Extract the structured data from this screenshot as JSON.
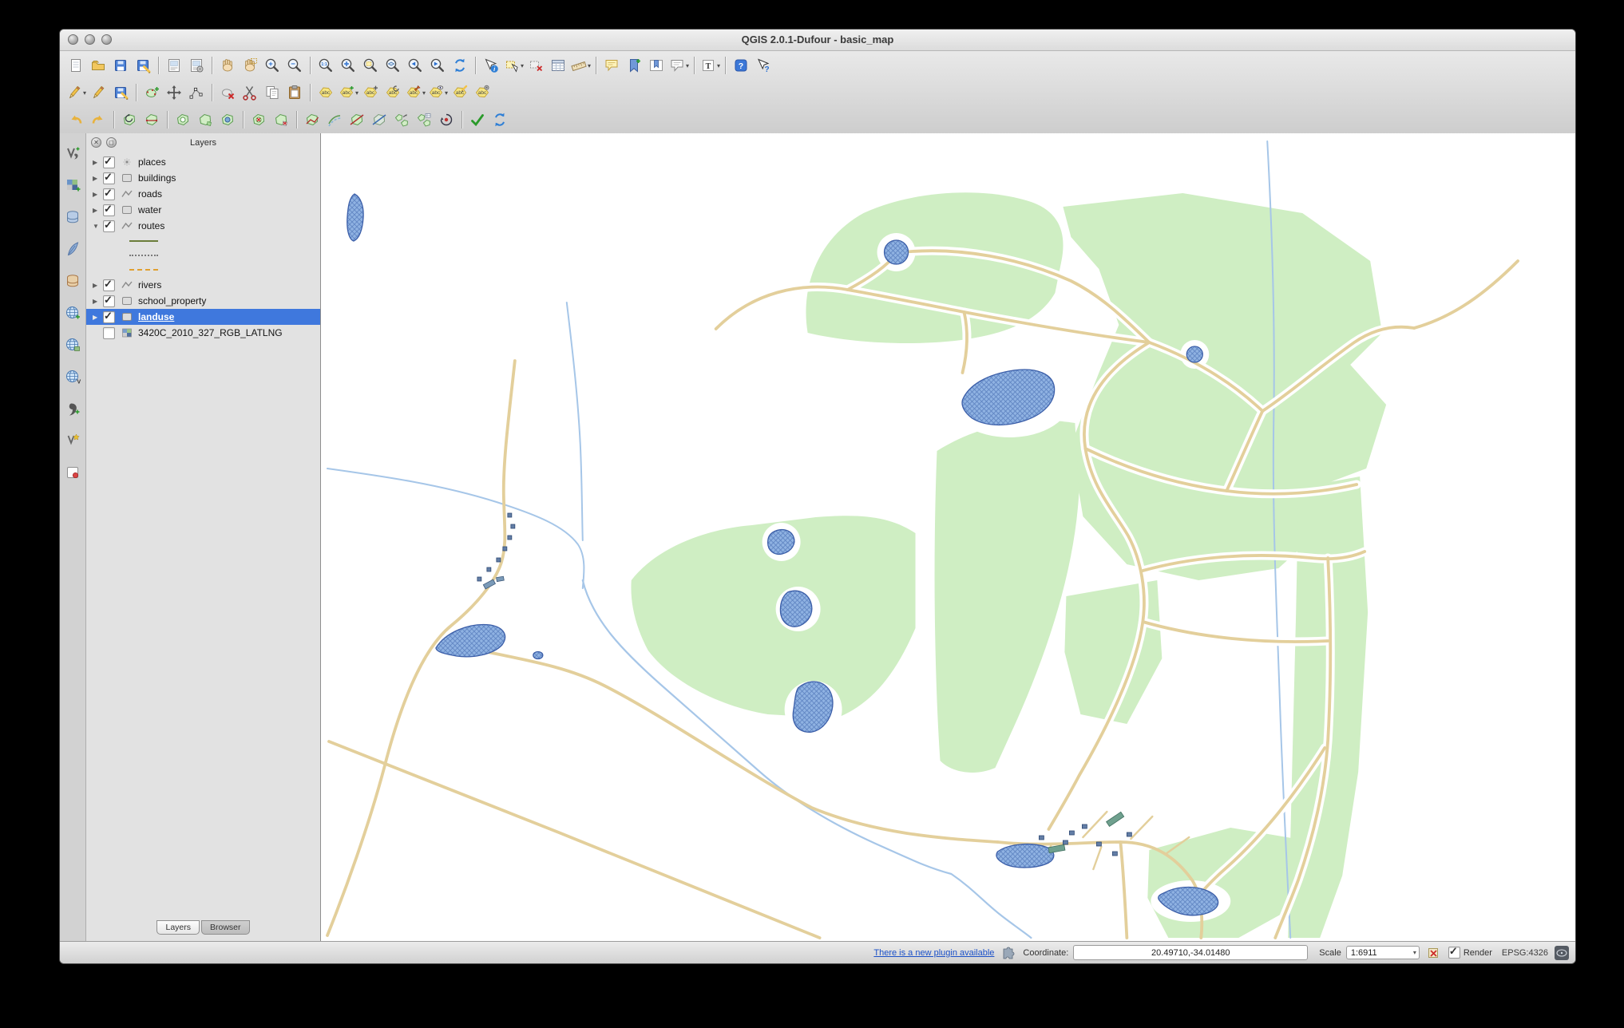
{
  "window": {
    "title": "QGIS 2.0.1-Dufour - basic_map"
  },
  "colors": {
    "selection": "#3f78dd",
    "landuse_green": "#cfeec3",
    "water_blue": "#8fb2e2",
    "road_tan": "#e3cf9b",
    "river_blue": "#a6c6e8"
  },
  "toolbars": {
    "main": [
      {
        "name": "new-project",
        "kind": "page"
      },
      {
        "name": "open-project",
        "kind": "folder"
      },
      {
        "name": "save-project",
        "kind": "floppy"
      },
      {
        "name": "save-project-as",
        "kind": "floppy-as"
      },
      {
        "sep": true
      },
      {
        "name": "new-print-composer",
        "kind": "composer"
      },
      {
        "name": "composer-manager",
        "kind": "composer-manager"
      },
      {
        "sep": true
      },
      {
        "name": "pan-map",
        "kind": "hand"
      },
      {
        "name": "pan-to-selection",
        "kind": "hand-sel"
      },
      {
        "name": "zoom-in",
        "kind": "zoom",
        "sub": "+"
      },
      {
        "name": "zoom-out",
        "kind": "zoom",
        "sub": "−"
      },
      {
        "sep": true
      },
      {
        "name": "zoom-native",
        "kind": "zoom",
        "sub": "1:1"
      },
      {
        "name": "zoom-full",
        "kind": "zoom-full"
      },
      {
        "name": "zoom-to-selection",
        "kind": "zoom-sel"
      },
      {
        "name": "zoom-to-layer",
        "kind": "zoom-layer"
      },
      {
        "name": "zoom-last",
        "kind": "zoom-prev"
      },
      {
        "name": "zoom-next",
        "kind": "zoom-next"
      },
      {
        "name": "refresh-map",
        "kind": "refresh"
      },
      {
        "sep": true
      },
      {
        "name": "identify-features",
        "kind": "identify"
      },
      {
        "name": "select-features",
        "kind": "select",
        "dropdown": true
      },
      {
        "name": "deselect-features",
        "kind": "deselect"
      },
      {
        "name": "open-attribute-table",
        "kind": "table"
      },
      {
        "name": "measure",
        "kind": "ruler",
        "dropdown": true
      },
      {
        "sep": true
      },
      {
        "name": "map-tips",
        "kind": "bubble"
      },
      {
        "name": "new-bookmark",
        "kind": "bookmark-new"
      },
      {
        "name": "show-bookmarks",
        "kind": "bookmark-show"
      },
      {
        "name": "annotation",
        "kind": "annotation",
        "dropdown": true
      },
      {
        "sep": true
      },
      {
        "name": "text-annotation",
        "kind": "text-annotation",
        "dropdown": true
      },
      {
        "sep": true
      },
      {
        "name": "help-contents",
        "kind": "help"
      },
      {
        "name": "whats-this",
        "kind": "whats-this"
      }
    ],
    "digitizing": [
      {
        "name": "current-edits",
        "kind": "pencil",
        "dropdown": true
      },
      {
        "name": "toggle-editing",
        "kind": "pencil"
      },
      {
        "name": "save-layer-edits",
        "kind": "floppy-pencil"
      },
      {
        "sep": true
      },
      {
        "name": "add-feature",
        "kind": "feature-add"
      },
      {
        "name": "move-feature",
        "kind": "feature-move"
      },
      {
        "name": "node-tool",
        "kind": "nodes"
      },
      {
        "sep": true
      },
      {
        "name": "delete-selected",
        "kind": "feature-delete"
      },
      {
        "name": "cut-features",
        "kind": "cut"
      },
      {
        "name": "copy-features",
        "kind": "copy"
      },
      {
        "name": "paste-features",
        "kind": "paste"
      },
      {
        "sep": true
      },
      {
        "name": "labeling",
        "kind": "label-abc"
      },
      {
        "name": "label-data-defined",
        "kind": "label-plus",
        "dropdown": true
      },
      {
        "name": "move-label",
        "kind": "label-move"
      },
      {
        "name": "rotate-label",
        "kind": "label-rotate"
      },
      {
        "name": "pin-labels",
        "kind": "label-pin",
        "dropdown": true
      },
      {
        "name": "show-hide-labels",
        "kind": "label-eye",
        "dropdown": true
      },
      {
        "name": "change-label",
        "kind": "label-edit"
      },
      {
        "name": "label-properties",
        "kind": "label-gear"
      }
    ],
    "advanced": [
      {
        "name": "undo",
        "kind": "undo"
      },
      {
        "name": "redo",
        "kind": "redo"
      },
      {
        "sep": true
      },
      {
        "name": "rotate-feature",
        "kind": "poly-rotate"
      },
      {
        "name": "simplify-feature",
        "kind": "poly-simplify"
      },
      {
        "sep": true
      },
      {
        "name": "add-ring",
        "kind": "poly-ring"
      },
      {
        "name": "add-part",
        "kind": "poly-part"
      },
      {
        "name": "fill-ring",
        "kind": "poly-fillring"
      },
      {
        "sep": true
      },
      {
        "name": "delete-ring",
        "kind": "poly-delring"
      },
      {
        "name": "delete-part",
        "kind": "poly-delpart"
      },
      {
        "sep": true
      },
      {
        "name": "reshape-features",
        "kind": "poly-reshape"
      },
      {
        "name": "offset-curve",
        "kind": "offset-curve"
      },
      {
        "name": "split-features",
        "kind": "split-features"
      },
      {
        "name": "split-parts",
        "kind": "split-parts"
      },
      {
        "name": "merge-features",
        "kind": "merge-features"
      },
      {
        "name": "merge-attributes",
        "kind": "merge-attributes"
      },
      {
        "name": "rotate-point-symbols",
        "kind": "rotate-point"
      },
      {
        "sep": true
      },
      {
        "name": "check-validity",
        "kind": "check"
      },
      {
        "name": "redraw",
        "kind": "refresh"
      }
    ],
    "layer_tools": [
      {
        "name": "add-vector-layer",
        "kind": "vector-add"
      },
      {
        "name": "add-raster-layer",
        "kind": "raster-add"
      },
      {
        "name": "add-postgis-layer",
        "kind": "db-elephant"
      },
      {
        "name": "add-spatialite-layer",
        "kind": "feather"
      },
      {
        "name": "add-mssql-layer",
        "kind": "db-generic"
      },
      {
        "name": "add-wms-layer",
        "kind": "globe-wms"
      },
      {
        "name": "add-wcs-layer",
        "kind": "globe-wcs"
      },
      {
        "name": "add-wfs-layer",
        "kind": "globe-wfs"
      },
      {
        "name": "add-delimited-text",
        "kind": "comma"
      },
      {
        "name": "new-shapefile-layer",
        "kind": "shapefile-new"
      },
      {
        "name": "remove-layer",
        "kind": "box-red"
      }
    ]
  },
  "layers_panel": {
    "title": "Layers",
    "items": [
      {
        "id": "places",
        "label": "places",
        "type": "point",
        "checked": true,
        "arrow": "right"
      },
      {
        "id": "buildings",
        "label": "buildings",
        "type": "polygon",
        "checked": true,
        "arrow": "right"
      },
      {
        "id": "roads",
        "label": "roads",
        "type": "line",
        "checked": true,
        "arrow": "right"
      },
      {
        "id": "water",
        "label": "water",
        "type": "polygon",
        "checked": true,
        "arrow": "right"
      },
      {
        "id": "routes",
        "label": "routes",
        "type": "line",
        "checked": true,
        "arrow": "down",
        "children": [
          {
            "swatch": "solid"
          },
          {
            "swatch": "dotted"
          },
          {
            "swatch": "dashed"
          }
        ]
      },
      {
        "id": "rivers",
        "label": "rivers",
        "type": "line",
        "checked": true,
        "arrow": "right"
      },
      {
        "id": "school_property",
        "label": "school_property",
        "type": "polygon",
        "checked": true,
        "arrow": "right"
      },
      {
        "id": "landuse",
        "label": "landuse",
        "type": "polygon",
        "checked": true,
        "selected": true,
        "arrow": "right"
      },
      {
        "id": "raster",
        "label": "3420C_2010_327_RGB_LATLNG",
        "type": "raster",
        "checked": false,
        "arrow": "none"
      }
    ],
    "tabs": [
      {
        "label": "Layers",
        "active": true
      },
      {
        "label": "Browser",
        "active": false
      }
    ]
  },
  "status_bar": {
    "plugin_link": "There is a new plugin available",
    "coordinate_label": "Coordinate:",
    "coordinate_value": "20.49710,-34.01480",
    "scale_label": "Scale",
    "scale_value": "1:6911",
    "render_label": "Render",
    "epsg": "EPSG:4326"
  }
}
